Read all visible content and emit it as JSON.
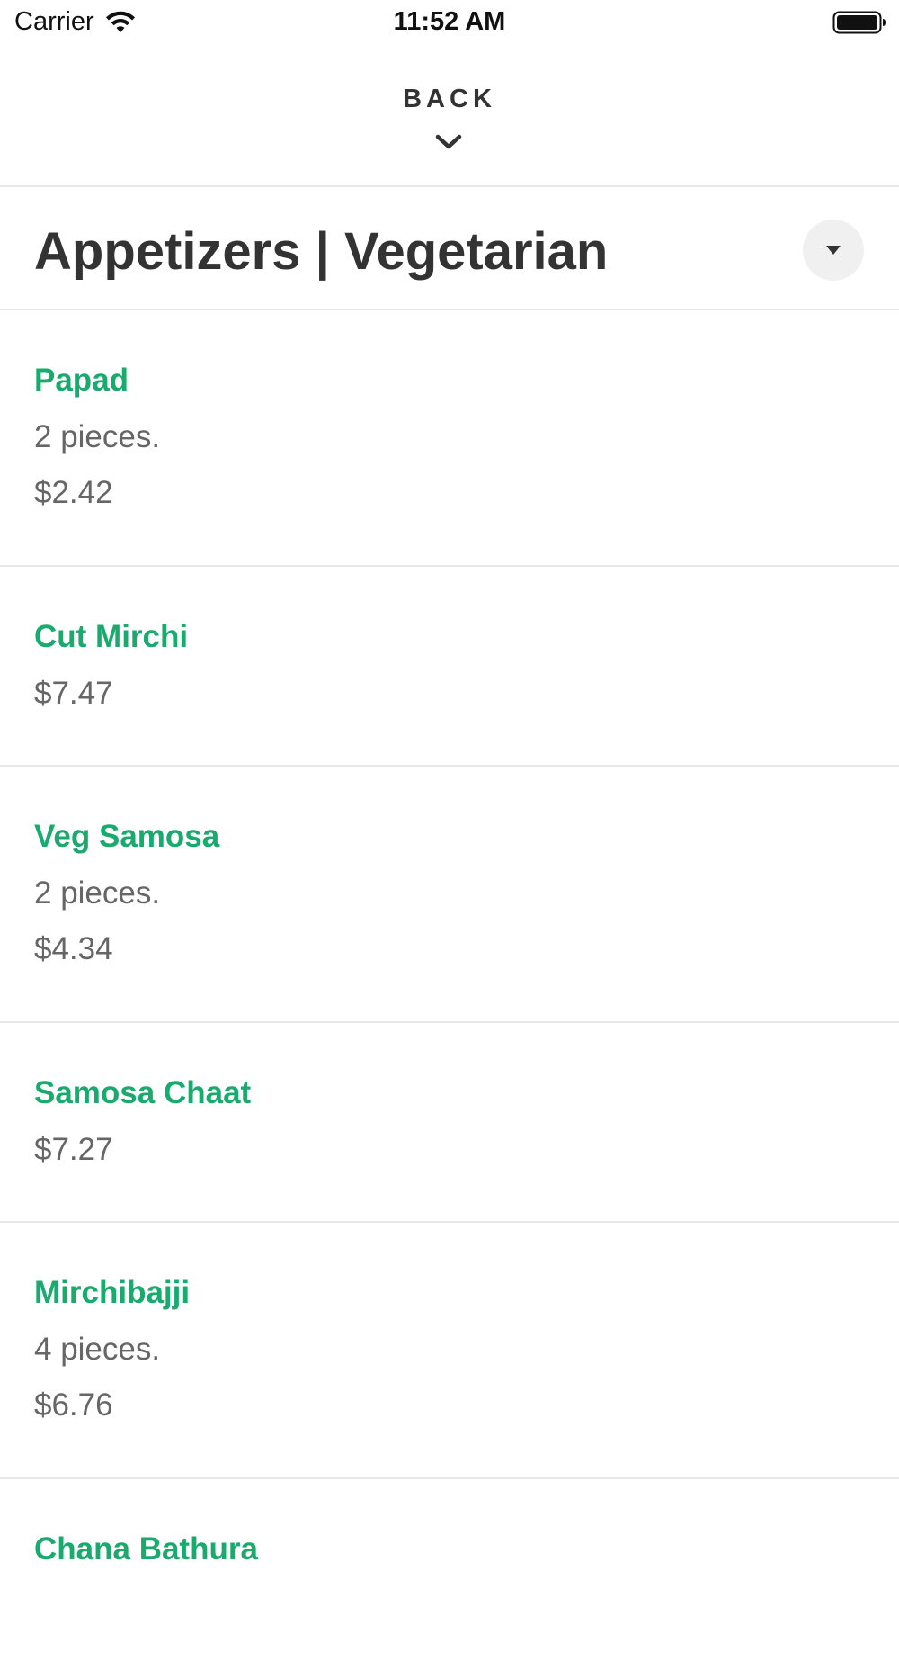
{
  "status_bar": {
    "carrier": "Carrier",
    "time": "11:52 AM"
  },
  "header": {
    "back_label": "BACK"
  },
  "category": {
    "title": "Appetizers | Vegetarian"
  },
  "colors": {
    "item_name": "#1aaa6e",
    "text_primary": "#333333",
    "text_secondary": "#666666",
    "divider": "#e8e8e8"
  },
  "icons": {
    "wifi": "wifi-icon",
    "battery": "battery-icon",
    "back": "chevron-down-icon",
    "dropdown": "caret-down-icon"
  },
  "menu": {
    "items": [
      {
        "name": "Papad",
        "description": "2 pieces.",
        "price": "$2.42"
      },
      {
        "name": "Cut Mirchi",
        "description": "",
        "price": "$7.47"
      },
      {
        "name": "Veg Samosa",
        "description": "2 pieces.",
        "price": "$4.34"
      },
      {
        "name": "Samosa Chaat",
        "description": "",
        "price": "$7.27"
      },
      {
        "name": "Mirchibajji",
        "description": "4 pieces.",
        "price": "$6.76"
      },
      {
        "name": "Chana Bathura",
        "description": "",
        "price": ""
      }
    ]
  }
}
